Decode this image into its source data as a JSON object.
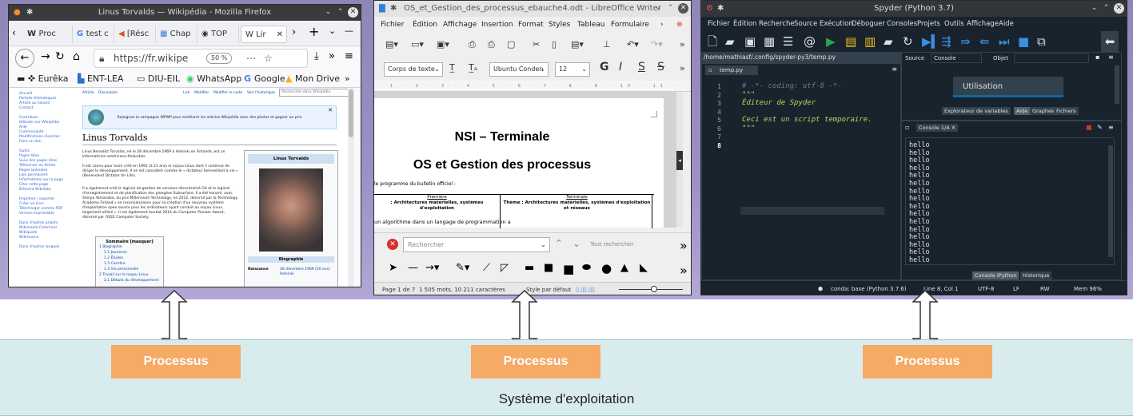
{
  "firefox": {
    "title": "Linus Torvalds — Wikipédia - Mozilla Firefox",
    "tabs": [
      "Proc",
      "test c",
      "[Résc",
      "Chap",
      "TOP",
      "W Lir"
    ],
    "url": "https://fr.wikipe",
    "zoom": "50 %",
    "bookmarks": [
      "Eurêka",
      "ENT-LEA",
      "DIU-EIL",
      "WhatsApp",
      "Google",
      "Mon Drive"
    ],
    "wiki": {
      "sidebar": [
        "Accueil",
        "Portails thématiques",
        "Article au hasard",
        "Contact",
        "",
        "Contribuer",
        "Débuter sur Wikipédia",
        "Aide",
        "Communauté",
        "Modifications récentes",
        "Faire un don",
        "",
        "Outils",
        "Pages liées",
        "Suivi des pages liées",
        "Téléverser un fichier",
        "Pages spéciales",
        "Lien permanent",
        "Informations sur la page",
        "Citer cette page",
        "Élément Wikidata",
        "",
        "Imprimer / exporter",
        "Créer un livre",
        "Télécharger comme PDF",
        "Version imprimable",
        "",
        "Dans d'autres projets",
        "Wikimedia Commons",
        "Wikiquote",
        "Wikisource",
        "",
        "Dans d'autres langues"
      ],
      "tabs": [
        "Article",
        "Discussion",
        "Lire",
        "Modifier",
        "Modifier le code",
        "Voir l'historique",
        "Rechercher dans Wikipédia"
      ],
      "banner": "Rejoignez la campagne WPWP pour améliorer les articles Wikipédia avec des photos et gagner un prix",
      "title": "Linus Torvalds",
      "para1": "Linus Benedict Torvalds, né le 28 décembre 1969 à Helsinki en Finlande, est un informaticien américano-finlandais.",
      "para2": "Il est connu pour avoir créé en 1991 (à 21 ans) le noyau Linux dont il continue de diriger le développement. Il en est considéré comme le « dictateur bienveillant à vie » (Benevolent Dictator for Life).",
      "para3": "Il a également créé le logiciel de gestion de versions décentralisé Git et le logiciel d'enregistrement et de planification des plongées Subsurface. Il a été honoré, avec Shinya Yamanaka, du prix Millennium Technology, en 2012, décerné par la Technology Academy Finland « en reconnaissance pour sa création d'un nouveau système d'exploitation open source pour les ordinateurs ayant conduit au noyau Linux, largement utilisé ». Il est également lauréat 2014 du Computer Pioneer Award, décerné par l'IEEE Computer Society.",
      "toc_title": "Sommaire [masquer]",
      "toc": [
        "1 Biographie",
        "1.1 Jeunesse",
        "1.2 Études",
        "1.3 Carrière",
        "1.4 Vie personnelle",
        "2 Travail sur le noyau Linux",
        "2.1 Débuts du développement"
      ],
      "infobox_title": "Linus Torvalds",
      "infobox_caption": "Biographie",
      "infobox_birth_label": "Naissance",
      "infobox_birth_value": "28 décembre 1969 (50 ans) Helsinki"
    }
  },
  "writer": {
    "title": "OS_et_Gestion_des_processus_ebauche4.odt - LibreOffice Writer",
    "menu": [
      "Fichier",
      "Édition",
      "Affichage",
      "Insertion",
      "Format",
      "Styles",
      "Tableau",
      "Formulaire"
    ],
    "para_style": "Corps de texte",
    "font": "Ubuntu Conden",
    "font_size": "12",
    "doc_title1": "NSI – Terminale",
    "doc_title2": "OS et Gestion des processus",
    "doc_line": "le programme du bulletin officiel :",
    "col1_head": "Première",
    "col1_text": ": Architectures matérielles, systèmes d'exploitation",
    "col2_head": "Terminale",
    "col2_text": "Thème : Architectures matérielles, systèmes d'exploitation et réseaux",
    "doc_line2": "un algorithme dans un langage de programmation a",
    "search_placeholder": "Rechercher",
    "search_all": "Tout rechercher",
    "status_page": "Page 1 de 7",
    "status_words": "1 505 mots, 10 211 caractères",
    "status_style": "Style par défaut"
  },
  "spyder": {
    "title": "Spyder (Python 3.7)",
    "menu": [
      "Fichier",
      "Édition",
      "Recherche",
      "Source",
      "Exécution",
      "Déboguer",
      "Consoles",
      "Projets",
      "Outils",
      "Affichage",
      "Aide"
    ],
    "path": "/home/mathiasf/.config/spyder-py3/temp.py",
    "file_tab": "temp.py",
    "code": [
      {
        "n": "1",
        "text": "# -*- coding: utf-8 -*-",
        "color": "#6e7a85"
      },
      {
        "n": "2",
        "text": "\"\"\"",
        "color": "#b2db5c"
      },
      {
        "n": "3",
        "text": "Éditeur de Spyder",
        "color": "#b2db5c"
      },
      {
        "n": "4",
        "text": "",
        "color": "#b2db5c"
      },
      {
        "n": "5",
        "text": "Ceci est un script temporaire.",
        "color": "#b2db5c"
      },
      {
        "n": "6",
        "text": "\"\"\"",
        "color": "#b2db5c"
      },
      {
        "n": "7",
        "text": "",
        "color": "#b2db5c"
      },
      {
        "n": "8",
        "text": "",
        "color": "#b2db5c"
      }
    ],
    "help_source_label": "Source",
    "help_source_value": "Console",
    "help_object_label": "Objet",
    "usage": "Utilisation",
    "help_tabs": [
      "Explorateur de variables",
      "Aide",
      "Graphes",
      "Fichiers"
    ],
    "console_tab": "Console 1/A",
    "console_lines": [
      "hello",
      "hello",
      "hello",
      "hello",
      "hello",
      "hello",
      "hello",
      "hello",
      "hello",
      "hello",
      "hello",
      "hello",
      "hello",
      "hello",
      "hello",
      "hello"
    ],
    "console_tabs": [
      "Console IPython",
      "Historique"
    ],
    "status": {
      "env": "conda: base (Python 3.7.6)",
      "pos": "Line 8, Col 1",
      "enc": "UTF-8",
      "eol": "LF",
      "rw": "RW",
      "mem": "Mem 96%"
    }
  },
  "diagram": {
    "process_label": "Processus",
    "os_label": "Système d'exploitation",
    "colors": {
      "process": "#f5aa66",
      "os_band": "#d9eced",
      "arrow": "#ffffff"
    }
  }
}
